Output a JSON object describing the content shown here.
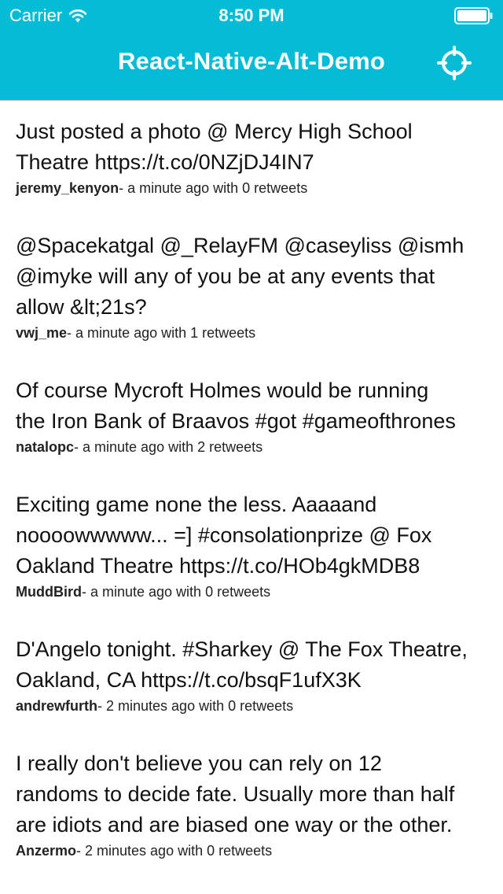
{
  "status_bar": {
    "carrier": "Carrier",
    "time": "8:50 PM"
  },
  "nav": {
    "title": "React-Native-Alt-Demo",
    "action_icon": "locate-icon"
  },
  "colors": {
    "header_bg": "#04bcd6",
    "text": "#111111"
  },
  "tweets": [
    {
      "text": "Just posted a photo @ Mercy High School\nTheatre https://t.co/0NZjDJ4IN7",
      "user": "jeremy_kenyon",
      "meta": "- a minute ago with 0 retweets"
    },
    {
      "text": "@Spacekatgal @_RelayFM @caseyliss @ismh\n@imyke will any of you be at any events that\nallow &lt;21s?",
      "user": "vwj_me",
      "meta": "- a minute ago with 1 retweets"
    },
    {
      "text": "Of course Mycroft Holmes would be running\nthe Iron Bank of Braavos #got #gameofthrones",
      "user": "natalopc",
      "meta": "- a minute ago with 2 retweets"
    },
    {
      "text": "Exciting game none the less. Aaaaand\nnoooowwwww... =] #consolationprize @ Fox\nOakland Theatre https://t.co/HOb4gkMDB8",
      "user": "MuddBird",
      "meta": "- a minute ago with 0 retweets"
    },
    {
      "text": "D'Angelo tonight. #Sharkey @ The Fox Theatre,\nOakland, CA https://t.co/bsqF1ufX3K",
      "user": "andrewfurth",
      "meta": "- 2 minutes ago with 0 retweets"
    },
    {
      "text": "I really don't believe you can rely on 12\nrandoms to decide fate. Usually more than half\nare idiots and are biased one way or the other.",
      "user": "Anzermo",
      "meta": "- 2 minutes ago with 0 retweets"
    }
  ]
}
